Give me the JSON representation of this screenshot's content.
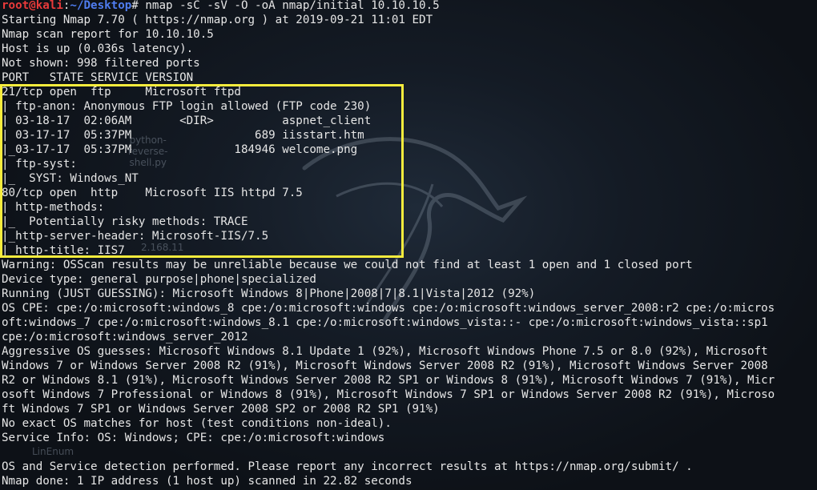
{
  "prompt": {
    "user_host": "root@kali",
    "separator": ":",
    "path": "~/Desktop",
    "symbol": "#",
    "command": " nmap -sC -sV -O -oA nmap/initial 10.10.10.5"
  },
  "desktop_ghosts": {
    "python_script": "python-\nreverse-\nshell.py",
    "linenum": "LinEnum",
    "ip_fragment": "2.168.11"
  },
  "output_lines": [
    "Starting Nmap 7.70 ( https://nmap.org ) at 2019-09-21 11:01 EDT",
    "Nmap scan report for 10.10.10.5",
    "Host is up (0.036s latency).",
    "Not shown: 998 filtered ports",
    "PORT   STATE SERVICE VERSION",
    "21/tcp open  ftp     Microsoft ftpd",
    "| ftp-anon: Anonymous FTP login allowed (FTP code 230)",
    "| 03-18-17  02:06AM       <DIR>          aspnet_client",
    "| 03-17-17  05:37PM                  689 iisstart.htm",
    "|_03-17-17  05:37PM               184946 welcome.png",
    "| ftp-syst: ",
    "|_  SYST: Windows_NT",
    "80/tcp open  http    Microsoft IIS httpd 7.5",
    "| http-methods: ",
    "|_  Potentially risky methods: TRACE",
    "|_http-server-header: Microsoft-IIS/7.5",
    "|_http-title: IIS7",
    "Warning: OSScan results may be unreliable because we could not find at least 1 open and 1 closed port",
    "Device type: general purpose|phone|specialized",
    "Running (JUST GUESSING): Microsoft Windows 8|Phone|2008|7|8.1|Vista|2012 (92%)",
    "OS CPE: cpe:/o:microsoft:windows_8 cpe:/o:microsoft:windows cpe:/o:microsoft:windows_server_2008:r2 cpe:/o:micros",
    "oft:windows_7 cpe:/o:microsoft:windows_8.1 cpe:/o:microsoft:windows_vista::- cpe:/o:microsoft:windows_vista::sp1",
    "cpe:/o:microsoft:windows_server_2012",
    "Aggressive OS guesses: Microsoft Windows 8.1 Update 1 (92%), Microsoft Windows Phone 7.5 or 8.0 (92%), Microsoft",
    "Windows 7 or Windows Server 2008 R2 (91%), Microsoft Windows Server 2008 R2 (91%), Microsoft Windows Server 2008",
    "R2 or Windows 8.1 (91%), Microsoft Windows Server 2008 R2 SP1 or Windows 8 (91%), Microsoft Windows 7 (91%), Micr",
    "osoft Windows 7 Professional or Windows 8 (91%), Microsoft Windows 7 SP1 or Windows Server 2008 R2 (91%), Microso",
    "ft Windows 7 SP1 or Windows Server 2008 SP2 or 2008 R2 SP1 (91%)",
    "No exact OS matches for host (test conditions non-ideal).",
    "Service Info: OS: Windows; CPE: cpe:/o:microsoft:windows",
    "",
    "OS and Service detection performed. Please report any incorrect results at https://nmap.org/submit/ .",
    "Nmap done: 1 IP address (1 host up) scanned in 22.82 seconds"
  ],
  "colors": {
    "highlight_box": "#f7ec3d",
    "prompt_user": "#e83a3a",
    "prompt_path": "#4f7df0",
    "text": "#e6e6e6",
    "background": "#0d1117"
  }
}
